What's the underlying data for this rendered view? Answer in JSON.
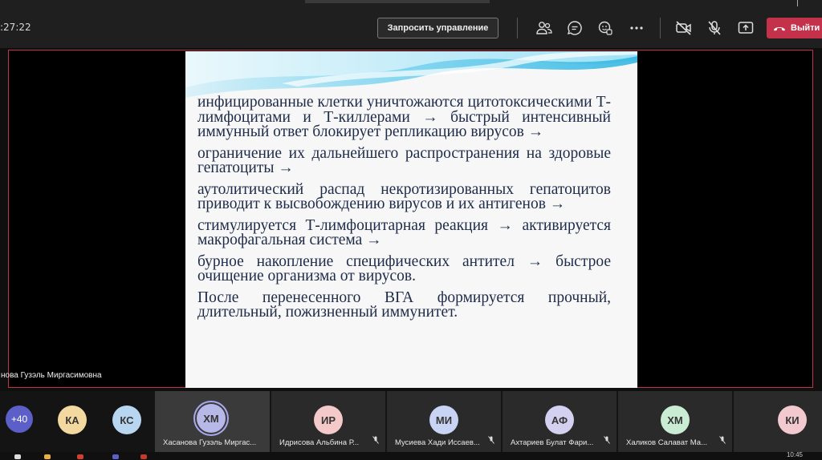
{
  "toolbar": {
    "timer": ":27:22",
    "request_control": "Запросить управление",
    "leave": "Выйти",
    "icons": [
      "participants-icon",
      "chat-icon",
      "reactions-icon",
      "more-icon",
      "camera-off-icon",
      "mic-off-icon",
      "share-icon",
      "phone-icon"
    ]
  },
  "colors": {
    "leave": "#c4314b",
    "stage_border": "#c4314b",
    "avatar_more": "#5b5fc7",
    "slide_text": "#1e2b4a"
  },
  "slide": {
    "paragraphs": [
      "инфицированные клетки уничтожаются цитотоксическими Т-лимфоцитами и Т-киллерами → быстрый интенсивный иммунный ответ блокирует репликацию вирусов →",
      "ограничение их дальнейшего распространения на здоровые гепатоциты →",
      "аутолитический распад некротизированных гепатоцитов приводит к высвобождению вирусов и их антигенов →",
      "стимулируется Т-лимфоцитарная реакция → активируется макрофагальная система →",
      "бурное накопление специфических антител → быстрое очищение организма от вирусов.",
      "После перенесенного ВГА формируется прочный, длительный, пожизненный иммунитет."
    ]
  },
  "presenter": {
    "name": "нова Гузэль Миргасимовна"
  },
  "participants": {
    "more_count": "+40",
    "small": [
      {
        "initials": "КА",
        "color": "#f3d9a0"
      },
      {
        "initials": "КС",
        "color": "#b9d6f0"
      }
    ],
    "tiles": [
      {
        "initials": "ХМ",
        "name": "Хасанова Гузэль Миргас...",
        "color": "#b8b8e8"
      },
      {
        "initials": "ИР",
        "name": "Идрисова Альбина Р...",
        "color": "#f3c9c9"
      },
      {
        "initials": "МИ",
        "name": "Мусиева Хади Иссаев...",
        "color": "#c9d3f3"
      },
      {
        "initials": "АФ",
        "name": "Ахтариев Булат Фари...",
        "color": "#d4d0f0"
      },
      {
        "initials": "ХМ",
        "name": "Халиков Салават Ма...",
        "color": "#c9ecd2"
      },
      {
        "initials": "КИ",
        "name": "",
        "color": "#f3c9d0"
      }
    ]
  },
  "taskbar": {
    "clock": "10:45"
  }
}
